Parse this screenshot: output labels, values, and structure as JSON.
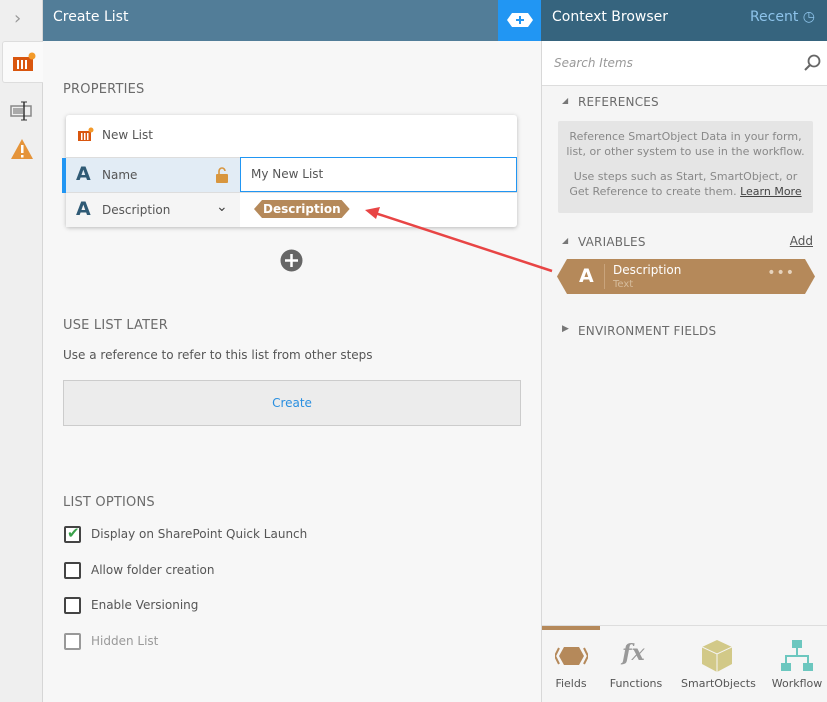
{
  "header": {
    "title": "Create List",
    "context_title": "Context Browser",
    "recent_label": "Recent"
  },
  "properties": {
    "heading": "PROPERTIES",
    "list_label": "New List",
    "name_label": "Name",
    "name_value": "My New List",
    "description_label": "Description",
    "description_token": "Description"
  },
  "use_later": {
    "heading": "USE LIST LATER",
    "hint": "Use a reference to refer to this list from other steps",
    "create_label": "Create"
  },
  "options": {
    "heading": "LIST OPTIONS",
    "items": [
      {
        "label": "Display on SharePoint Quick Launch",
        "checked": true
      },
      {
        "label": "Allow folder creation",
        "checked": false
      },
      {
        "label": "Enable Versioning",
        "checked": false
      },
      {
        "label": "Hidden List",
        "checked": false,
        "disabled": true
      }
    ]
  },
  "context": {
    "search_placeholder": "Search Items",
    "references_heading": "REFERENCES",
    "references_text1": "Reference SmartObject Data in your form, list, or other system to use in the workflow.",
    "references_text2": "Use steps such as Start, SmartObject, or Get Reference to create them.",
    "learn_more": "Learn More",
    "variables_heading": "VARIABLES",
    "add_label": "Add",
    "variable": {
      "name": "Description",
      "type": "Text",
      "icon_letter": "A"
    },
    "environment_heading": "ENVIRONMENT FIELDS"
  },
  "bottom_tabs": [
    {
      "label": "Fields"
    },
    {
      "label": "Functions"
    },
    {
      "label": "SmartObjects"
    },
    {
      "label": "Workflow"
    }
  ],
  "colors": {
    "header": "#527d98",
    "accent": "#2196f3",
    "field": "#b5895a",
    "arrow": "#e84545"
  }
}
